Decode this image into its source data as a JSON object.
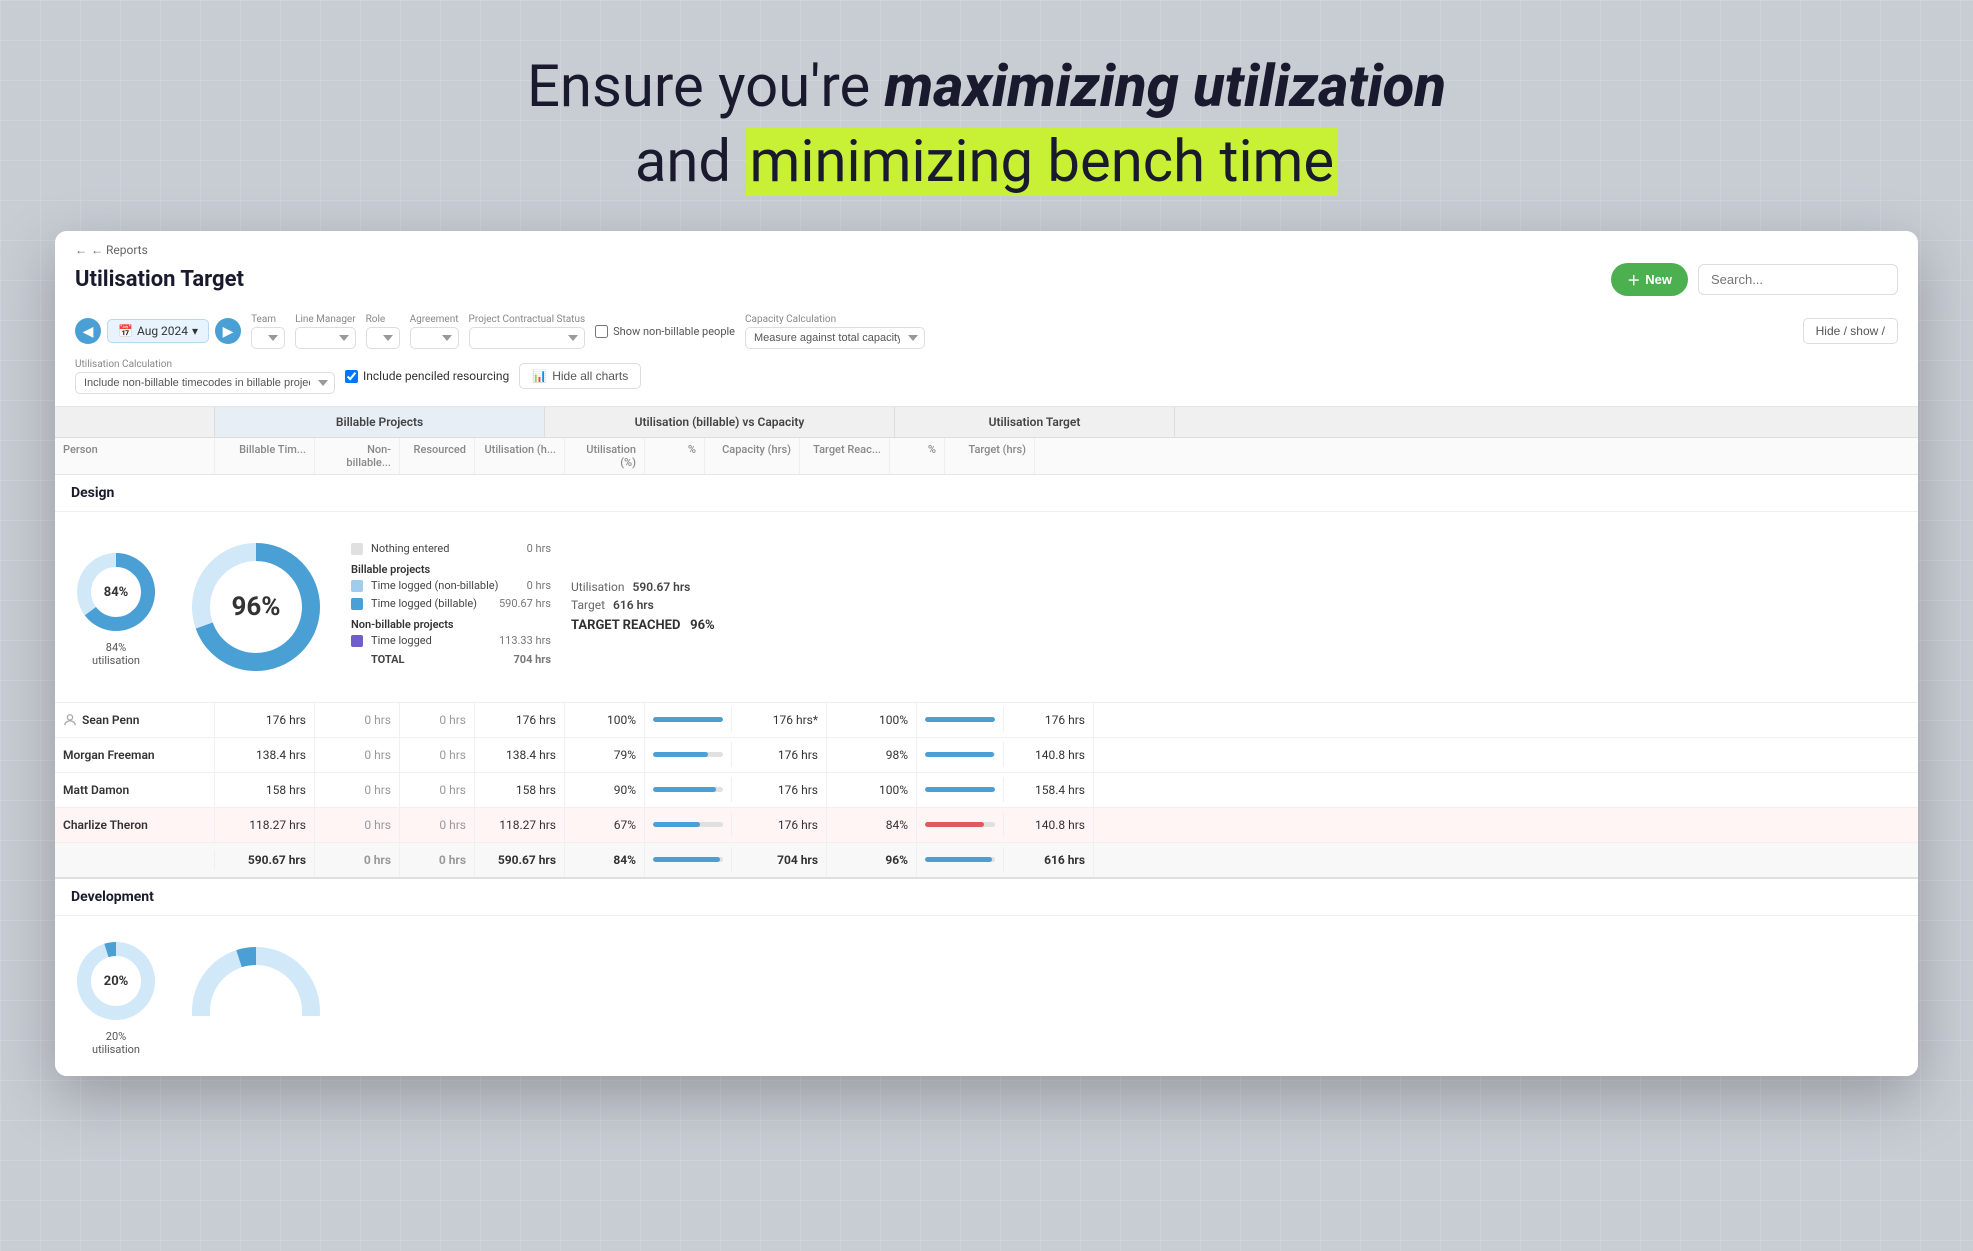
{
  "hero": {
    "line1_prefix": "Ensure you're ",
    "line1_bold": "maximizing utilization",
    "line2_prefix": "and ",
    "line2_highlighted": "minimizing bench time"
  },
  "header": {
    "back_label": "← Reports",
    "title": "Utilisation Target",
    "new_btn_label": "New",
    "search_placeholder": "Search..."
  },
  "filters": {
    "date_label": "Aug 2024",
    "team_label": "Team",
    "line_manager_label": "Line Manager",
    "role_label": "Role",
    "agreement_label": "Agreement",
    "project_status_label": "Project Contractual Status",
    "show_non_billable_label": "Show non-billable people",
    "capacity_calc_label": "Capacity Calculation",
    "capacity_calc_value": "Measure against total capacity",
    "hide_show_label": "Hide / show /",
    "utilisation_calc_label": "Utilisation Calculation",
    "utilisation_calc_value": "Include non-billable timecodes in billable projects",
    "include_penciled_label": "Include penciled resourcing",
    "hide_charts_label": "Hide all charts"
  },
  "table": {
    "col_groups": [
      {
        "label": "",
        "key": "person"
      },
      {
        "label": "Billable Projects",
        "key": "billable"
      },
      {
        "label": "Utilisation (billable) vs Capacity",
        "key": "utilisation"
      },
      {
        "label": "Utilisation Target",
        "key": "target"
      }
    ],
    "sub_headers": [
      "Person",
      "Billable Tim...",
      "Non-billable...",
      "Resourced",
      "Utilisation (h...",
      "Utilisation (%)",
      "%",
      "Capacity (hrs)",
      "Target Reac...",
      "%",
      "Target (hrs)"
    ]
  },
  "design_section": {
    "title": "Design",
    "small_donut": {
      "pct": 84,
      "label": "84%\nutilisation"
    },
    "big_donut": {
      "pct": "96%"
    },
    "legend": {
      "nothing_entered": "0 hrs",
      "time_logged_non_billable": "0 hrs",
      "time_logged_billable": "590.67 hrs",
      "time_logged_non_billable_proj": "113.33 hrs",
      "total": "704 hrs"
    },
    "stats": {
      "utilisation": "590.67 hrs",
      "target": "616 hrs",
      "target_reached_label": "TARGET REACHED",
      "target_reached_pct": "96%"
    },
    "rows": [
      {
        "name": "Sean Penn",
        "billable_time": "176 hrs",
        "non_billable": "0 hrs",
        "resourced": "0 hrs",
        "util_h": "176 hrs",
        "util_pct": "100%",
        "capacity": "176 hrs*",
        "t_reached": "100%",
        "t_pct_bar": 100,
        "t_hrs": "176 hrs",
        "bar_color": "blue",
        "has_icon": true
      },
      {
        "name": "Morgan Freeman",
        "billable_time": "138.4 hrs",
        "non_billable": "0 hrs",
        "resourced": "0 hrs",
        "util_h": "138.4 hrs",
        "util_pct": "79%",
        "capacity": "176 hrs",
        "t_reached": "98%",
        "t_pct_bar": 98,
        "t_hrs": "140.8 hrs",
        "bar_color": "blue",
        "has_icon": false
      },
      {
        "name": "Matt Damon",
        "billable_time": "158 hrs",
        "non_billable": "0 hrs",
        "resourced": "0 hrs",
        "util_h": "158 hrs",
        "util_pct": "90%",
        "capacity": "176 hrs",
        "t_reached": "100%",
        "t_pct_bar": 100,
        "t_hrs": "158.4 hrs",
        "bar_color": "blue",
        "has_icon": false
      },
      {
        "name": "Charlize Theron",
        "billable_time": "118.27 hrs",
        "non_billable": "0 hrs",
        "resourced": "0 hrs",
        "util_h": "118.27 hrs",
        "util_pct": "67%",
        "capacity": "176 hrs",
        "t_reached": "84%",
        "t_pct_bar": 84,
        "t_hrs": "140.8 hrs",
        "bar_color": "red",
        "has_icon": false,
        "highlighted": true
      }
    ],
    "totals": {
      "billable_time": "590.67 hrs",
      "non_billable": "0 hrs",
      "resourced": "0 hrs",
      "util_h": "590.67 hrs",
      "util_pct": "84%",
      "capacity": "704 hrs",
      "t_reached": "96%",
      "t_pct_bar": 96,
      "t_hrs": "616 hrs"
    }
  },
  "development_section": {
    "title": "Development",
    "small_donut_pct": 20
  }
}
